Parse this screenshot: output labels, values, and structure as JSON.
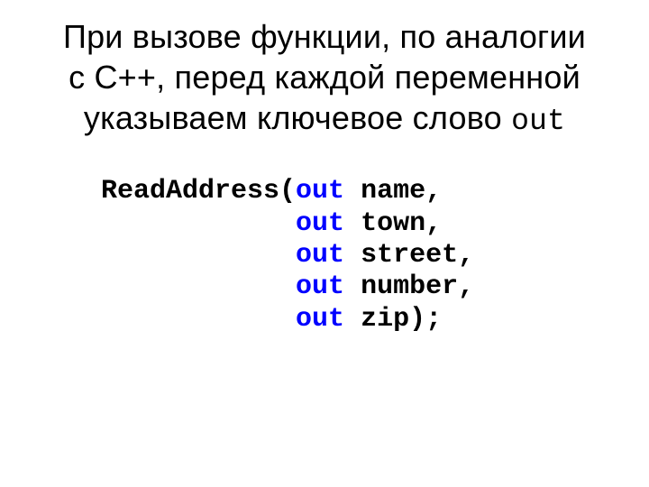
{
  "title": {
    "line1": "При вызове функции, по аналогии",
    "line2_pre": "с С++, перед каждой переменной",
    "line3_pre": "указываем ключевое слово ",
    "kw": "out"
  },
  "code": {
    "fn": "ReadAddress(",
    "kw": "out",
    "indent": "            ",
    "args": {
      "a1": " name,",
      "a2": " town,",
      "a3": " street,",
      "a4": " number,",
      "a5": " zip);"
    }
  }
}
